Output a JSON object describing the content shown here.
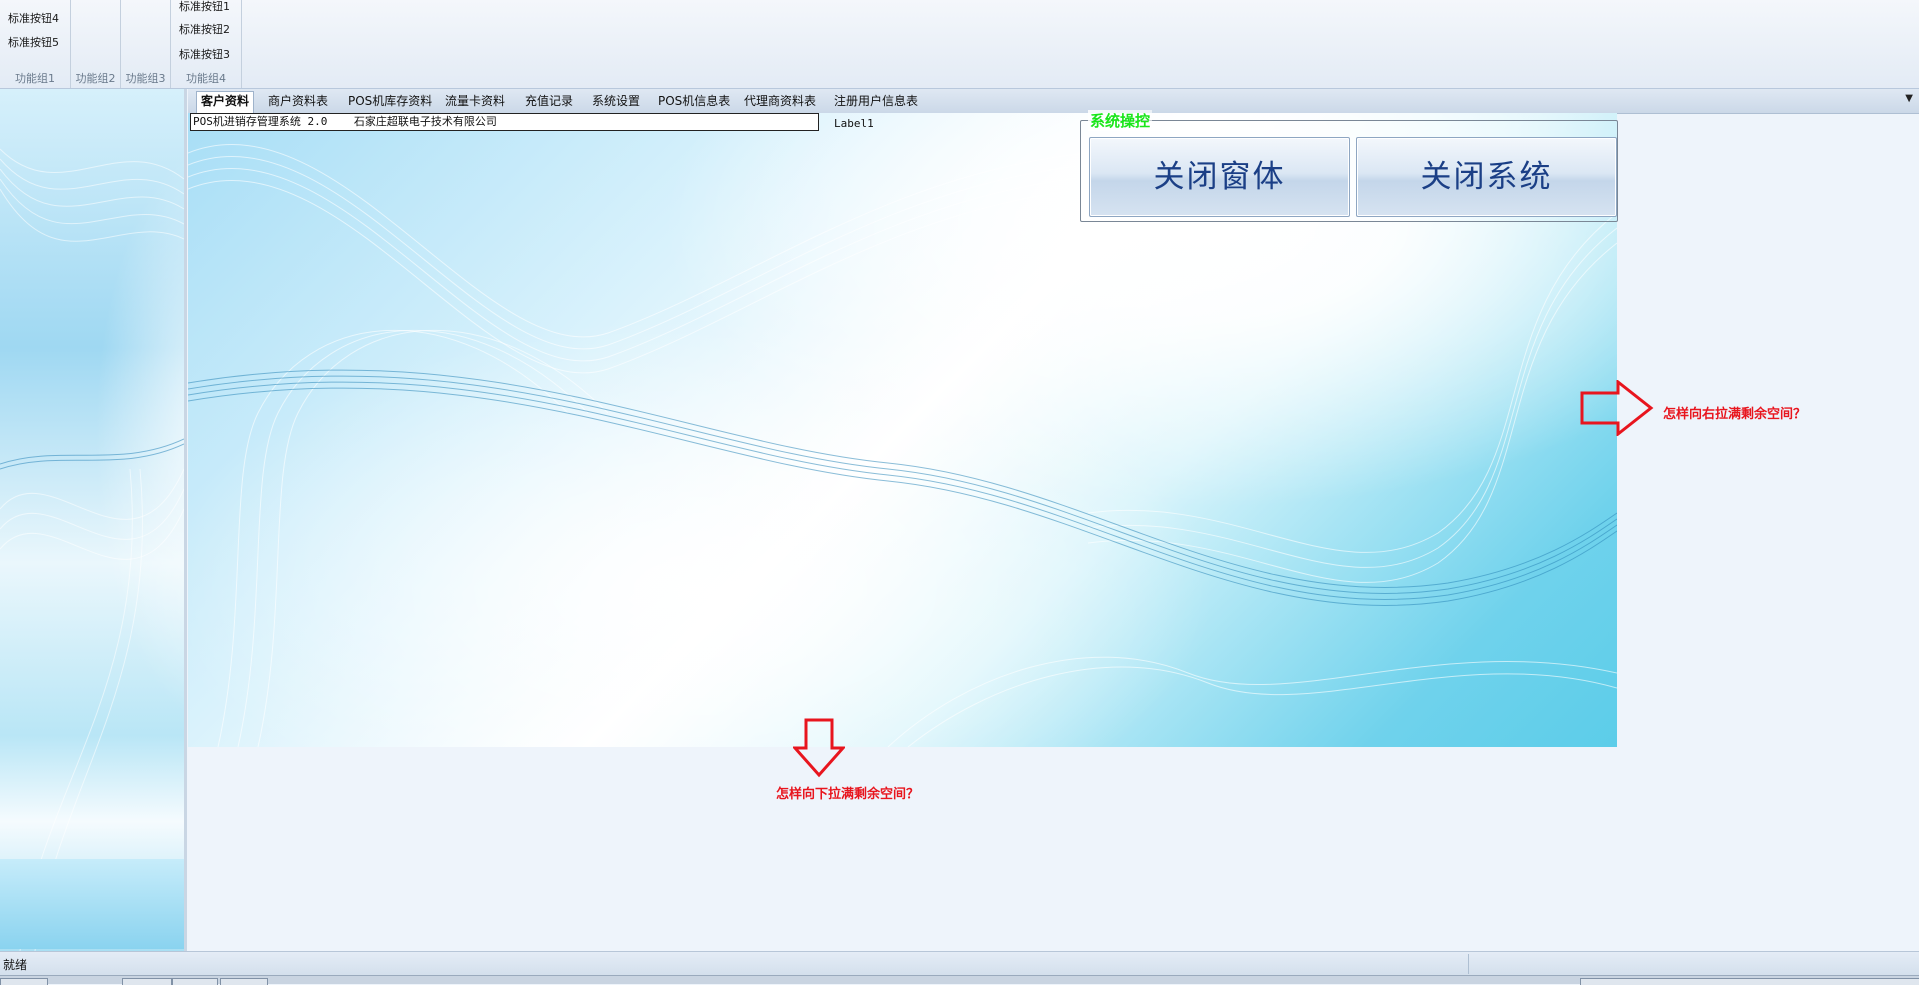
{
  "ribbon": {
    "groups": [
      {
        "caption": "功能组1",
        "buttons": [
          "标准按钮4",
          "标准按钮5"
        ]
      },
      {
        "caption": "功能组2",
        "buttons": []
      },
      {
        "caption": "功能组3",
        "buttons": []
      },
      {
        "caption": "功能组4",
        "buttons": [
          "标准按钮1",
          "标准按钮2",
          "标准按钮3"
        ]
      }
    ]
  },
  "tabs": [
    {
      "label": "客户资料",
      "active": true
    },
    {
      "label": "商户资料表",
      "active": false
    },
    {
      "label": "POS机库存资料",
      "active": false
    },
    {
      "label": "流量卡资料",
      "active": false
    },
    {
      "label": "充值记录",
      "active": false
    },
    {
      "label": "系统设置",
      "active": false
    },
    {
      "label": "POS机信息表",
      "active": false
    },
    {
      "label": "代理商资料表",
      "active": false
    },
    {
      "label": "注册用户信息表",
      "active": false
    }
  ],
  "tab_dropdown_icon": "▼",
  "main": {
    "title_text": "POS机进销存管理系统 2.0    石家庄超联电子技术有限公司",
    "label1": "Label1",
    "groupbox_title": "系统操控",
    "groupbox_title_color": "#19e619",
    "buttons": {
      "close_window": "关闭窗体",
      "close_system": "关闭系统"
    }
  },
  "annotations": {
    "right": "怎样向右拉满剩余空间？",
    "down": "怎样向下拉满剩余空间？",
    "color": "#e8151e"
  },
  "status": {
    "text": "就绪"
  }
}
